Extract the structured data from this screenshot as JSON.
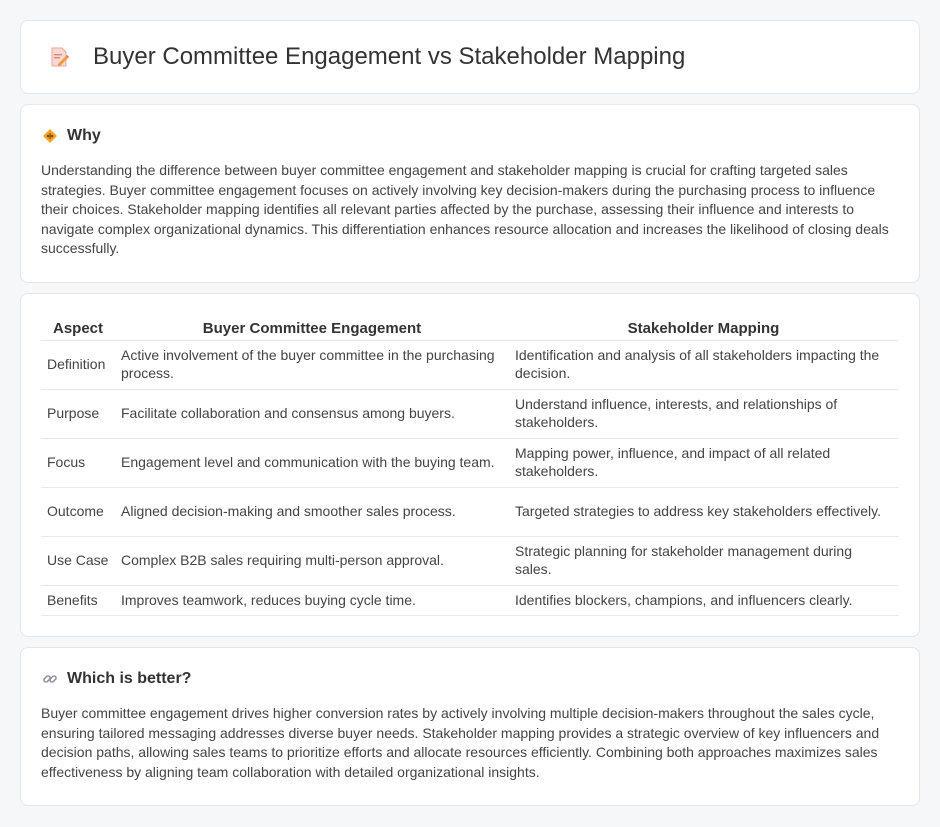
{
  "header": {
    "icon": "edit-document-icon",
    "title": "Buyer Committee Engagement vs Stakeholder Mapping"
  },
  "why": {
    "icon": "diamond-warning-icon",
    "heading": "Why",
    "text": "Understanding the difference between buyer committee engagement and stakeholder mapping is crucial for crafting targeted sales strategies. Buyer committee engagement focuses on actively involving key decision-makers during the purchasing process to influence their choices. Stakeholder mapping identifies all relevant parties affected by the purchase, assessing their influence and interests to navigate complex organizational dynamics. This differentiation enhances resource allocation and increases the likelihood of closing deals successfully."
  },
  "table": {
    "headers": [
      "Aspect",
      "Buyer Committee Engagement",
      "Stakeholder Mapping"
    ],
    "rows": [
      [
        "Definition",
        "Active involvement of the buyer committee in the purchasing process.",
        "Identification and analysis of all stakeholders impacting the decision."
      ],
      [
        "Purpose",
        "Facilitate collaboration and consensus among buyers.",
        "Understand influence, interests, and relationships of stakeholders."
      ],
      [
        "Focus",
        "Engagement level and communication with the buying team.",
        "Mapping power, influence, and impact of all related stakeholders."
      ],
      [
        "Outcome",
        "Aligned decision-making and smoother sales process.",
        "Targeted strategies to address key stakeholders effectively."
      ],
      [
        "Use Case",
        "Complex B2B sales requiring multi-person approval.",
        "Strategic planning for stakeholder management during sales."
      ],
      [
        "Benefits",
        "Improves teamwork, reduces buying cycle time.",
        "Identifies blockers, champions, and influencers clearly."
      ]
    ]
  },
  "better": {
    "icon": "link-icon",
    "heading": "Which is better?",
    "text": "Buyer committee engagement drives higher conversion rates by actively involving multiple decision-makers throughout the sales cycle, ensuring tailored messaging addresses diverse buyer needs. Stakeholder mapping provides a strategic overview of key influencers and decision paths, allowing sales teams to prioritize efforts and allocate resources efficiently. Combining both approaches maximizes sales effectiveness by aligning team collaboration with detailed organizational insights."
  },
  "colors": {
    "background": "#f6f7f9",
    "card": "#ffffff",
    "border": "#e4e6ea",
    "accent": "#f0a030"
  }
}
